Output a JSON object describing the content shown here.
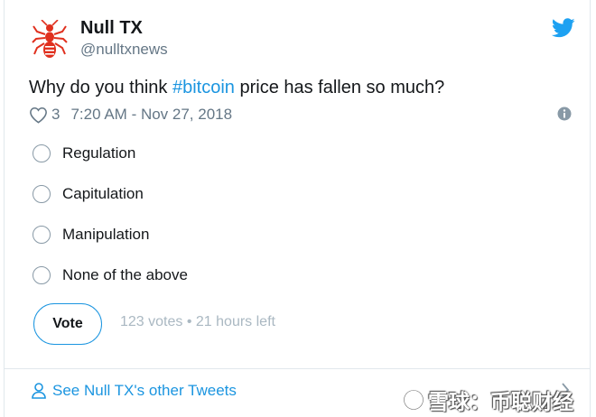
{
  "user": {
    "display_name": "Null TX",
    "handle": "@nulltxnews",
    "avatar_icon": "ant-logo-icon",
    "brand_icon": "twitter-bird-icon"
  },
  "tweet": {
    "text_before": "Why do you think ",
    "hashtag": "#bitcoin",
    "text_after": " price has fallen so much?",
    "like_count": "3",
    "timestamp": "7:20 AM - Nov 27, 2018"
  },
  "poll": {
    "options": [
      {
        "label": "Regulation"
      },
      {
        "label": "Capitulation"
      },
      {
        "label": "Manipulation"
      },
      {
        "label": "None of the above"
      }
    ],
    "vote_label": "Vote",
    "votes": "123 votes",
    "separator": "•",
    "time_left": "21 hours left"
  },
  "footer": {
    "link_text": "See Null TX's other Tweets"
  },
  "watermark": {
    "text": "雪球：币聪财经"
  },
  "colors": {
    "accent": "#1b95e0",
    "text": "#14171a",
    "muted": "#657786",
    "avatar_red": "#e0301e"
  }
}
